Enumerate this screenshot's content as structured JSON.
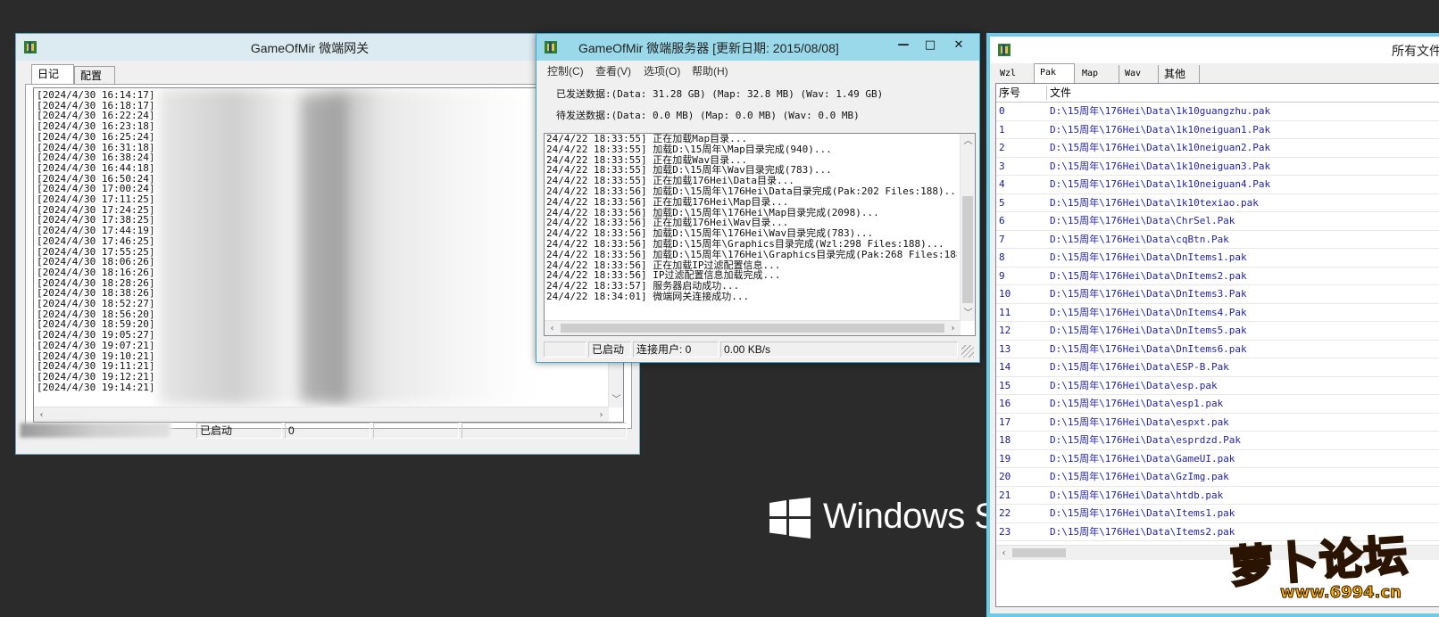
{
  "desktop": {
    "brand_text": "Windows S",
    "colors": {
      "desktop_bg": "#2b2b2b",
      "title_active": "#99d9ea",
      "title_inactive": "#dcebf2"
    }
  },
  "gateway": {
    "title": "GameOfMir 微端网关",
    "tabs": [
      "日记",
      "配置"
    ],
    "log_times": [
      "[2024/4/30 16:14:17]",
      "[2024/4/30 16:18:17]",
      "[2024/4/30 16:22:24]",
      "[2024/4/30 16:23:18]",
      "[2024/4/30 16:25:24]",
      "[2024/4/30 16:31:18]",
      "[2024/4/30 16:38:24]",
      "[2024/4/30 16:44:18]",
      "[2024/4/30 16:50:24]",
      "[2024/4/30 17:00:24]",
      "[2024/4/30 17:11:25]",
      "[2024/4/30 17:24:25]",
      "[2024/4/30 17:38:25]",
      "[2024/4/30 17:44:19]",
      "[2024/4/30 17:46:25]",
      "[2024/4/30 17:55:25]",
      "[2024/4/30 18:06:26]",
      "[2024/4/30 18:16:26]",
      "[2024/4/30 18:28:26]",
      "[2024/4/30 18:38:26]",
      "[2024/4/30 18:52:27]",
      "[2024/4/30 18:56:20]",
      "[2024/4/30 18:59:20]",
      "[2024/4/30 19:05:27]",
      "[2024/4/30 19:07:21]",
      "[2024/4/30 19:10:21]",
      "[2024/4/30 19:11:21]",
      "[2024/4/30 19:12:21]",
      "[2024/4/30 19:14:21]"
    ],
    "status": {
      "state": "已启动",
      "count": "0"
    }
  },
  "server": {
    "title": "GameOfMir 微端服务器 [更新日期: 2015/08/08]",
    "caption_buttons": {
      "minimize": "—",
      "maximize": "□",
      "close": "✕"
    },
    "menu": [
      "控制(C)",
      "查看(V)",
      "选项(O)",
      "帮助(H)"
    ],
    "sent": "已发送数据:(Data: 31.28 GB) (Map: 32.8 MB) (Wav: 1.49 GB)",
    "pending": "待发送数据:(Data: 0.0 MB) (Map: 0.0 MB) (Wav: 0.0 MB)",
    "log": [
      "24/4/22 18:33:55] 正在加载Map目录...",
      "24/4/22 18:33:55] 加载D:\\15周年\\Map目录完成(940)...",
      "24/4/22 18:33:55] 正在加载Wav目录...",
      "24/4/22 18:33:55] 加载D:\\15周年\\Wav目录完成(783)...",
      "24/4/22 18:33:55] 正在加载176Hei\\Data目录...",
      "24/4/22 18:33:56] 加载D:\\15周年\\176Hei\\Data目录完成(Pak:202 Files:188)...",
      "24/4/22 18:33:56] 正在加载176Hei\\Map目录...",
      "24/4/22 18:33:56] 加载D:\\15周年\\176Hei\\Map目录完成(2098)...",
      "24/4/22 18:33:56] 正在加载176Hei\\Wav目录...",
      "24/4/22 18:33:56] 加载D:\\15周年\\176Hei\\Wav目录完成(783)...",
      "24/4/22 18:33:56] 加载D:\\15周年\\Graphics目录完成(Wzl:298 Files:188)...",
      "24/4/22 18:33:56] 加载D:\\15周年\\176Hei\\Graphics目录完成(Pak:268 Files:188)...",
      "24/4/22 18:33:56] 正在加载IP过滤配置信息...",
      "24/4/22 18:33:56] IP过滤配置信息加载完成...",
      "24/4/22 18:33:57] 服务器启动成功...",
      "24/4/22 18:34:01] 微端网关连接成功..."
    ],
    "status": {
      "state": "已启动",
      "users": "连接用户: 0",
      "speed": "0.00 KB/s"
    }
  },
  "files": {
    "title": "所有文件",
    "tabs": [
      "Wzl",
      "Pak",
      "Map",
      "Wav",
      "其他"
    ],
    "active_tab": "Pak",
    "columns": [
      "序号",
      "文件"
    ],
    "rows": [
      {
        "idx": "0",
        "file": "D:\\15周年\\176Hei\\Data\\1k10guangzhu.pak"
      },
      {
        "idx": "1",
        "file": "D:\\15周年\\176Hei\\Data\\1k10neiguan1.Pak"
      },
      {
        "idx": "2",
        "file": "D:\\15周年\\176Hei\\Data\\1k10neiguan2.Pak"
      },
      {
        "idx": "3",
        "file": "D:\\15周年\\176Hei\\Data\\1k10neiguan3.Pak"
      },
      {
        "idx": "4",
        "file": "D:\\15周年\\176Hei\\Data\\1k10neiguan4.Pak"
      },
      {
        "idx": "5",
        "file": "D:\\15周年\\176Hei\\Data\\1k10texiao.pak"
      },
      {
        "idx": "6",
        "file": "D:\\15周年\\176Hei\\Data\\ChrSel.Pak"
      },
      {
        "idx": "7",
        "file": "D:\\15周年\\176Hei\\Data\\cqBtn.Pak"
      },
      {
        "idx": "8",
        "file": "D:\\15周年\\176Hei\\Data\\DnItems1.pak"
      },
      {
        "idx": "9",
        "file": "D:\\15周年\\176Hei\\Data\\DnItems2.pak"
      },
      {
        "idx": "10",
        "file": "D:\\15周年\\176Hei\\Data\\DnItems3.Pak"
      },
      {
        "idx": "11",
        "file": "D:\\15周年\\176Hei\\Data\\DnItems4.Pak"
      },
      {
        "idx": "12",
        "file": "D:\\15周年\\176Hei\\Data\\DnItems5.pak"
      },
      {
        "idx": "13",
        "file": "D:\\15周年\\176Hei\\Data\\DnItems6.pak"
      },
      {
        "idx": "14",
        "file": "D:\\15周年\\176Hei\\Data\\ESP-B.Pak"
      },
      {
        "idx": "15",
        "file": "D:\\15周年\\176Hei\\Data\\esp.pak"
      },
      {
        "idx": "16",
        "file": "D:\\15周年\\176Hei\\Data\\esp1.pak"
      },
      {
        "idx": "17",
        "file": "D:\\15周年\\176Hei\\Data\\espxt.pak"
      },
      {
        "idx": "18",
        "file": "D:\\15周年\\176Hei\\Data\\esprdzd.Pak"
      },
      {
        "idx": "19",
        "file": "D:\\15周年\\176Hei\\Data\\GameUI.pak"
      },
      {
        "idx": "20",
        "file": "D:\\15周年\\176Hei\\Data\\GzImg.pak"
      },
      {
        "idx": "21",
        "file": "D:\\15周年\\176Hei\\Data\\htdb.pak"
      },
      {
        "idx": "22",
        "file": "D:\\15周年\\176Hei\\Data\\Items1.pak"
      },
      {
        "idx": "23",
        "file": "D:\\15周年\\176Hei\\Data\\Items2.pak"
      }
    ]
  },
  "watermark": {
    "logo_text": "萝卜论坛",
    "url": "www.6994.cn"
  }
}
